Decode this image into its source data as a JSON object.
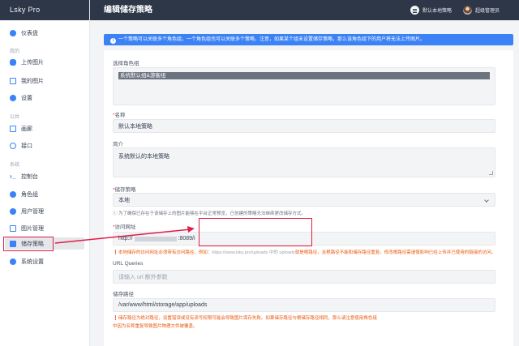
{
  "app": {
    "brand": "Lsky Pro"
  },
  "header": {
    "title": "编辑储存策略",
    "library_label": "默认本地策略",
    "user_name": "超级管理员"
  },
  "sidebar": {
    "items": [
      {
        "label": "仪表盘",
        "icon": "dashboard-icon"
      },
      {
        "section": "我的"
      },
      {
        "label": "上传图片",
        "icon": "upload-cloud-icon"
      },
      {
        "label": "我的图片",
        "icon": "images-icon"
      },
      {
        "label": "设置",
        "icon": "user-settings-icon"
      },
      {
        "section": "公共"
      },
      {
        "label": "画廊",
        "icon": "gallery-icon"
      },
      {
        "label": "接口",
        "icon": "api-icon"
      },
      {
        "section": "系统"
      },
      {
        "label": "控制台",
        "icon": "terminal-icon"
      },
      {
        "label": "角色组",
        "icon": "users-icon"
      },
      {
        "label": "用户管理",
        "icon": "user-manage-icon"
      },
      {
        "label": "图片管理",
        "icon": "image-manage-icon"
      },
      {
        "label": "储存策略",
        "icon": "storage-icon",
        "active": true
      },
      {
        "label": "系统设置",
        "icon": "gears-icon"
      }
    ]
  },
  "alert": {
    "text": "一个策略可以关联多个角色组，一个角色组也可以关联多个策略，注意，如果某个组未设置储存策略，那么该角色组下的用户将无法上传图片。"
  },
  "form": {
    "role_group": {
      "label": "选择角色组",
      "selected": "系统默认组&游客组"
    },
    "name": {
      "label": "名称",
      "value": "默认本地策略"
    },
    "intro": {
      "label": "简介",
      "value": "系统默认的本地策略"
    },
    "strategy": {
      "label": "储存策略",
      "value": "本地",
      "help": "为了确保已存在于该储存上的图片能够在平台正常预览，已创建的策略无法继续更改储存方式。"
    },
    "url": {
      "label": "访问网址",
      "value_prefix": "http://",
      "value_suffix": ":8089/i",
      "help": "本地储存的访问网址必须带有访问路径，例如：",
      "help_example": "https://www.lsky.pro/uploads 中的 uploads",
      "help_tail": "就是根路径，且根路径不能和储存路径重复。修改根路径需谨慎影响已经上传并已使用的链接的访问。"
    },
    "url_queries": {
      "label": "URL Queries",
      "placeholder": "请输入 url 额外参数"
    },
    "storage_path": {
      "label": "储存路径",
      "value": "/var/www/html/storage/app/uploads",
      "help1": "储存路径为绝对路径，设置错误或没有读写权限可能会导致图片保存失败。如果储存路径与根储存路径相同，那么请注意使用角色组",
      "help2": "中因为名称重复导致图片物理文件被覆盖。"
    }
  },
  "colors": {
    "topbar": "#2d3748",
    "accent": "#3b82f6",
    "annotation": "#e11d48",
    "warning": "#ea580c"
  }
}
